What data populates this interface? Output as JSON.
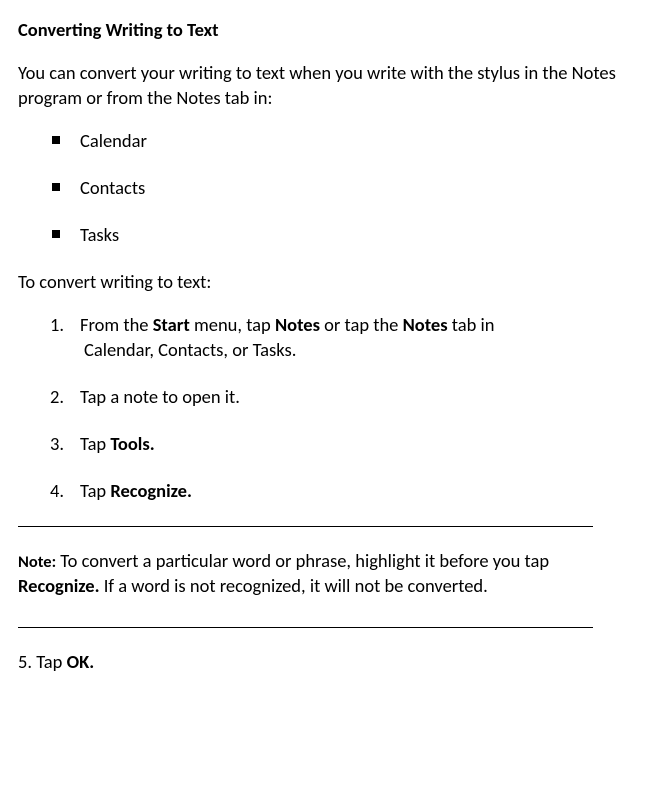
{
  "title": "Converting Writing to Text",
  "intro": "You can convert your writing to text when you write with the stylus in the Notes program or from the Notes tab in:",
  "bullets": [
    "Calendar",
    "Contacts",
    "Tasks"
  ],
  "subhead": "To convert writing to text:",
  "steps": {
    "s1a": "From the ",
    "s1b": "Start",
    "s1c": " menu, tap ",
    "s1d": "Notes",
    "s1e": " or tap the ",
    "s1f": "Notes",
    "s1g": " tab in",
    "s1h": "Calendar, Contacts, or Tasks.",
    "s2": "Tap a note to open it.",
    "s3a": "Tap ",
    "s3b": "Tools.",
    "s4a": "Tap ",
    "s4b": "Recognize."
  },
  "note": {
    "label": "Note:",
    "a": " To convert a particular word or phrase, highlight it before you tap ",
    "b": "Recognize.",
    "c": " If a word is not recognized, it will not be converted."
  },
  "final": {
    "a": "5. Tap ",
    "b": "OK."
  }
}
